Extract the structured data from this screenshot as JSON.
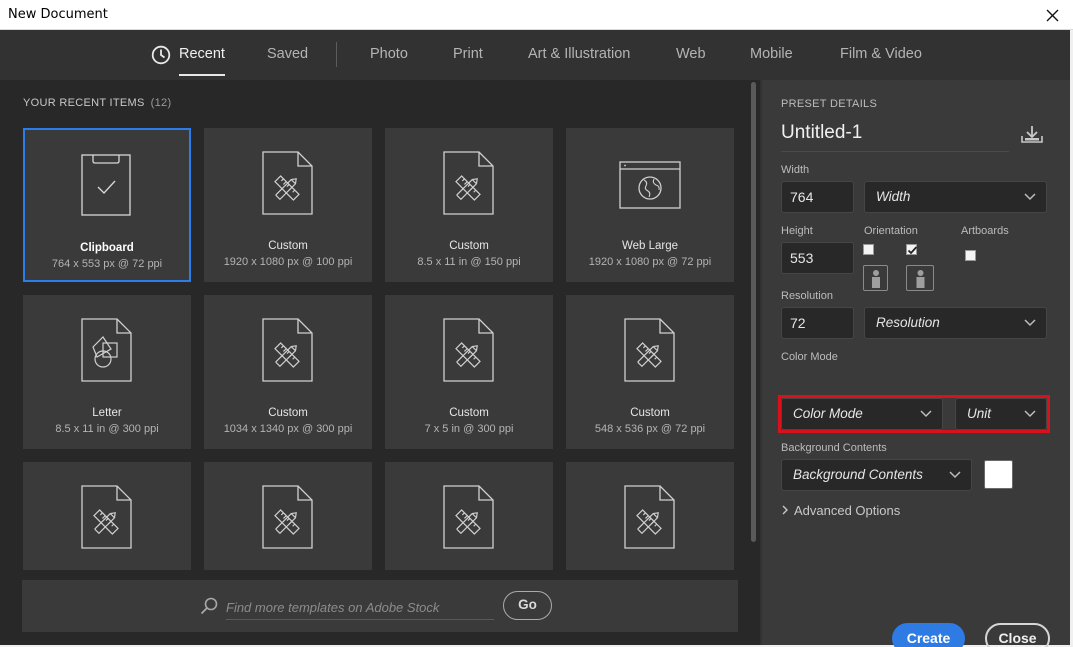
{
  "window": {
    "title": "New Document"
  },
  "tabs": [
    {
      "label": "Recent",
      "active": true
    },
    {
      "label": "Saved"
    },
    {
      "label": "Photo"
    },
    {
      "label": "Print"
    },
    {
      "label": "Art & Illustration"
    },
    {
      "label": "Web"
    },
    {
      "label": "Mobile"
    },
    {
      "label": "Film & Video"
    }
  ],
  "recent": {
    "header": "YOUR RECENT ITEMS",
    "count": "(12)",
    "items": [
      {
        "name": "Clipboard",
        "dims": "764 x 553 px @ 72 ppi",
        "icon": "clipboard-icon",
        "selected": true
      },
      {
        "name": "Custom",
        "dims": "1920 x 1080 px @ 100 ppi",
        "icon": "custom-document-icon"
      },
      {
        "name": "Custom",
        "dims": "8.5 x 11 in @ 150 ppi",
        "icon": "custom-document-icon"
      },
      {
        "name": "Web Large",
        "dims": "1920 x 1080 px @ 72 ppi",
        "icon": "web-globe-icon"
      },
      {
        "name": "Letter",
        "dims": "8.5 x 11 in @ 300 ppi",
        "icon": "letter-shapes-icon"
      },
      {
        "name": "Custom",
        "dims": "1034 x 1340 px @ 300 ppi",
        "icon": "custom-document-icon"
      },
      {
        "name": "Custom",
        "dims": "7 x 5 in @ 300 ppi",
        "icon": "custom-document-icon"
      },
      {
        "name": "Custom",
        "dims": "548 x 536 px @ 72 ppi",
        "icon": "custom-document-icon"
      },
      {
        "name": "",
        "dims": "",
        "icon": "custom-document-icon"
      },
      {
        "name": "",
        "dims": "",
        "icon": "custom-document-icon"
      },
      {
        "name": "",
        "dims": "",
        "icon": "custom-document-icon"
      },
      {
        "name": "",
        "dims": "",
        "icon": "custom-document-icon"
      }
    ]
  },
  "stock": {
    "placeholder": "Find more templates on Adobe Stock",
    "go_label": "Go"
  },
  "preset": {
    "header": "PRESET DETAILS",
    "doc_name": "Untitled-1",
    "width_label": "Width",
    "width_value": "764",
    "width_unit": "Width",
    "height_label": "Height",
    "height_value": "553",
    "orientation_label": "Orientation",
    "artboards_label": "Artboards",
    "resolution_label": "Resolution",
    "resolution_value": "72",
    "resolution_unit": "Resolution",
    "color_mode_label": "Color Mode",
    "color_mode_value": "Color Mode",
    "color_unit_value": "Unit",
    "bg_label": "Background Contents",
    "bg_value": "Background Contents",
    "bg_swatch_color": "#ffffff",
    "advanced_label": "Advanced Options"
  },
  "actions": {
    "create_label": "Create",
    "close_label": "Close"
  },
  "colors": {
    "accent": "#2d7be3",
    "highlight": "#d9111a"
  }
}
